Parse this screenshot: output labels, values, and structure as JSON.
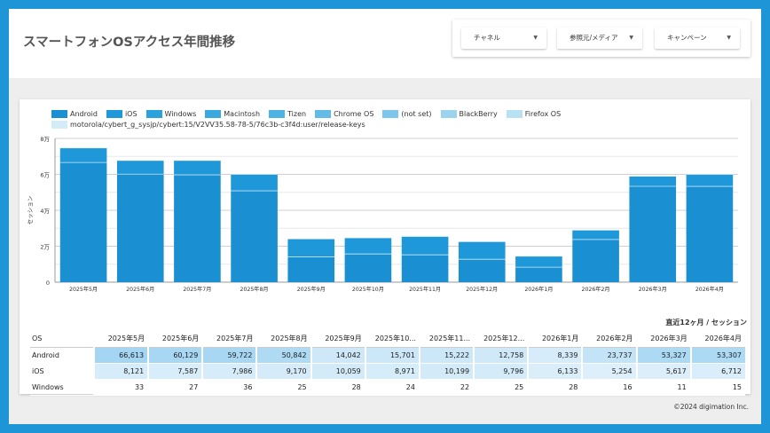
{
  "page": {
    "title": "スマートフォンOSアクセス年間推移",
    "footer": "©2024 digimation Inc."
  },
  "filters": [
    {
      "label": "チャネル"
    },
    {
      "label": "参照元/メディア"
    },
    {
      "label": "キャンペーン"
    }
  ],
  "colors": {
    "android": "#1a8fd2",
    "ios": "#1e98d8",
    "windows": "#2aa2dd",
    "macintosh": "#3aa9e0",
    "tizen": "#4db2e4",
    "chromeos": "#63bce8",
    "notset": "#7ec7ec",
    "blackberry": "#9cd4f0",
    "firefoxos": "#b8e1f4",
    "motorola": "#d4ecf8"
  },
  "chart_data": {
    "type": "bar",
    "stacked": true,
    "ylabel": "セッション",
    "ylim": [
      0,
      80000
    ],
    "yticks": [
      "0",
      "2万",
      "4万",
      "6万",
      "8万"
    ],
    "categories": [
      "2025年5月",
      "2025年6月",
      "2025年7月",
      "2025年8月",
      "2025年9月",
      "2025年10月",
      "2025年11月",
      "2025年12月",
      "2026年1月",
      "2026年2月",
      "2026年3月",
      "2026年4月"
    ],
    "legend": [
      "Android",
      "iOS",
      "Windows",
      "Macintosh",
      "Tizen",
      "Chrome OS",
      "(not set)",
      "BlackBerry",
      "Firefox OS",
      "motorola/cybert_g_sysjp/cybert:15/V2VV35.58-78-5/76c3b-c3f4d:user/release-keys"
    ],
    "series": [
      {
        "name": "Android",
        "values": [
          66613,
          60129,
          59722,
          50842,
          14042,
          15701,
          15222,
          12758,
          8339,
          23737,
          53327,
          53307
        ]
      },
      {
        "name": "iOS",
        "values": [
          8121,
          7587,
          7986,
          9170,
          10059,
          8971,
          10199,
          9796,
          6133,
          5254,
          5617,
          6712
        ]
      },
      {
        "name": "Windows",
        "values": [
          33,
          27,
          36,
          25,
          28,
          24,
          22,
          25,
          28,
          16,
          11,
          15
        ]
      }
    ]
  },
  "table": {
    "subtitle": "直近12ヶ月 / セッション",
    "headers": [
      "OS",
      "2025年5月",
      "2025年6月",
      "2025年7月",
      "2025年8月",
      "2025年9月",
      "2025年10...",
      "2025年11...",
      "2025年12...",
      "2026年1月",
      "2026年2月",
      "2026年3月",
      "2026年4月"
    ],
    "rows": [
      {
        "os": "Android",
        "values": [
          "66,613",
          "60,129",
          "59,722",
          "50,842",
          "14,042",
          "15,701",
          "15,222",
          "12,758",
          "8,339",
          "23,737",
          "53,327",
          "53,307"
        ]
      },
      {
        "os": "iOS",
        "values": [
          "8,121",
          "7,587",
          "7,986",
          "9,170",
          "10,059",
          "8,971",
          "10,199",
          "9,796",
          "6,133",
          "5,254",
          "5,617",
          "6,712"
        ]
      },
      {
        "os": "Windows",
        "values": [
          "33",
          "27",
          "36",
          "25",
          "28",
          "24",
          "22",
          "25",
          "28",
          "16",
          "11",
          "15"
        ]
      }
    ]
  }
}
